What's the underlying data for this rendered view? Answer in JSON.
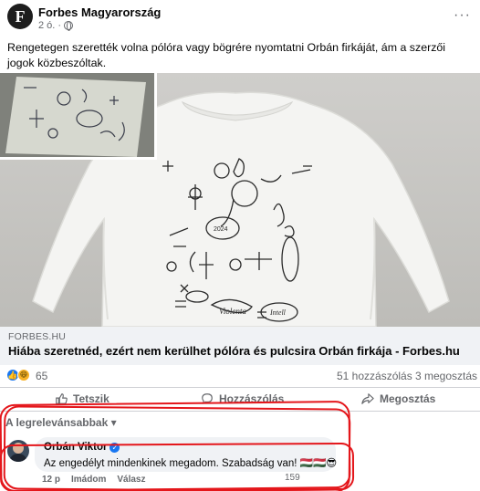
{
  "post": {
    "page_name": "Forbes Magyarország",
    "avatar_letter": "F",
    "time": "2 ó.",
    "text": "Rengetegen szerették volna pólóra vagy bögrére nyomtatni Orbán firkáját, ám a szerzői jogok közbeszóltak.",
    "more_label": "···"
  },
  "drawing_labels": {
    "label_1": "Violenta",
    "label_2": "Intell",
    "label_3": "2024"
  },
  "link_preview": {
    "domain": "FORBES.HU",
    "title": "Hiába szeretnéd, ezért nem kerülhet pólóra és pulcsira Orbán firkája - Forbes.hu"
  },
  "stats": {
    "reactions_count": "65",
    "comments": "51 hozzászólás",
    "shares": "3 megosztás"
  },
  "actions": {
    "like": "Tetszik",
    "comment": "Hozzászólás",
    "share": "Megosztás"
  },
  "comments_section": {
    "sort_label": "A legrelevánsabbak ▾"
  },
  "comment": {
    "author": "Orbán Viktor",
    "text": "Az engedélyt mindenkinek megadom. Szabadság van! 🇭🇺🇭🇺😎",
    "time": "12 p",
    "like_label": "Imádom",
    "reply_label": "Válasz",
    "reaction_count": "159"
  },
  "colors": {
    "facebook_blue": "#1877f2",
    "annotation_red": "#e4161b",
    "secondary_text": "#65676b"
  }
}
